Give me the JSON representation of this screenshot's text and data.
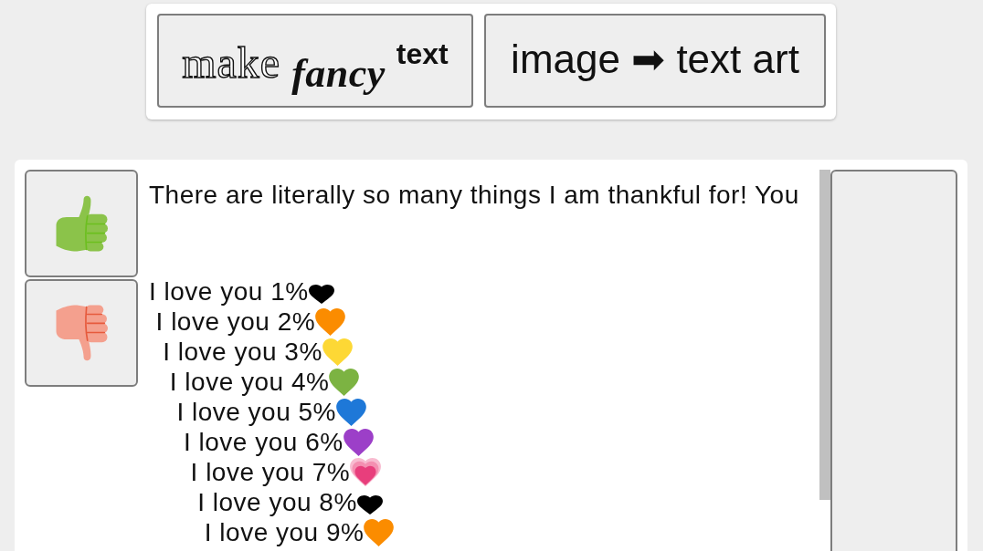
{
  "header_buttons": [
    {
      "kind": "fancy",
      "parts": [
        "make",
        "fancy",
        "text"
      ]
    },
    {
      "kind": "plain",
      "parts": [
        "image ➡ text art"
      ]
    }
  ],
  "editor": {
    "intro": "There are literally so many things I am thankful for! You",
    "lines": [
      {
        "text": "I love you 1%",
        "kind": "plain",
        "color": "#000000"
      },
      {
        "text": "I love you 2%",
        "kind": "emoji",
        "color": "#fb8c00"
      },
      {
        "text": "I love you 3%",
        "kind": "emoji",
        "color": "#fdd835"
      },
      {
        "text": "I love you 4%",
        "kind": "emoji",
        "color": "#7cb342"
      },
      {
        "text": "I love you 5%",
        "kind": "emoji",
        "color": "#1e78d8"
      },
      {
        "text": "I love you 6%",
        "kind": "emoji",
        "color": "#9c3fc8"
      },
      {
        "text": "I love you 7%",
        "kind": "growing",
        "color": "#e83e7c"
      },
      {
        "text": "I love you 8%",
        "kind": "plain",
        "color": "#000000"
      },
      {
        "text": "I love you 9%",
        "kind": "emoji",
        "color": "#fb8c00"
      }
    ]
  }
}
